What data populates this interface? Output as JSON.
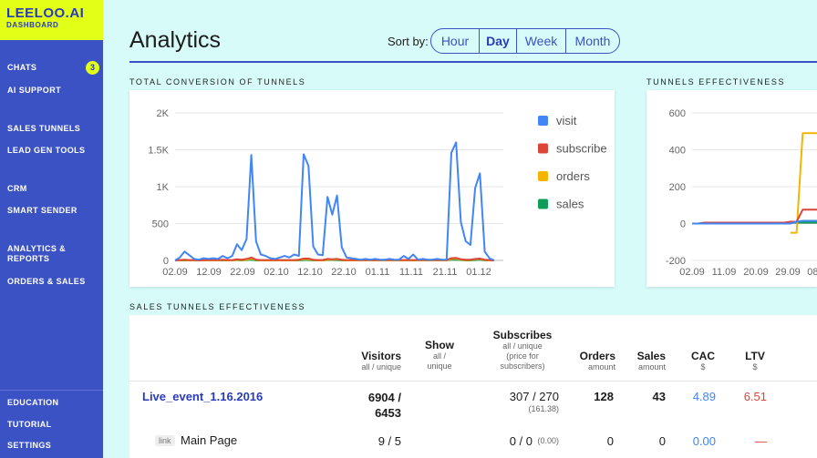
{
  "brand": {
    "name": "LEELOO.AI",
    "subtitle": "DASHBOARD"
  },
  "sidebar": {
    "items": [
      {
        "label": "CHATS",
        "badge": "3"
      },
      {
        "label": "AI SUPPORT"
      },
      {
        "label": "SALES TUNNELS"
      },
      {
        "label": "LEAD GEN TOOLS"
      },
      {
        "label": "CRM"
      },
      {
        "label": "SMART SENDER"
      },
      {
        "label": "ANALYTICS &\nREPORTS"
      },
      {
        "label": "ORDERS & SALES"
      }
    ],
    "bottom_items": [
      {
        "label": "EDUCATION"
      },
      {
        "label": "TUTORIAL"
      },
      {
        "label": "SETTINGS"
      }
    ]
  },
  "header": {
    "title": "Analytics",
    "sort_label": "Sort by:",
    "sort_options": [
      "Hour",
      "Day",
      "Week",
      "Month"
    ],
    "active_sort": "Day"
  },
  "sections": {
    "total_conversion": "TOTAL CONVERSION OF TUNNELS",
    "tunnels_effectiveness": "TUNNELS EFFECTIVENESS",
    "sales_tunnels_effectiveness": "SALES TUNNELS EFFECTIVENESS"
  },
  "colors": {
    "accent": "#3b52c4",
    "brand_yellow": "#e2ff17",
    "visit": "#4285f4",
    "subscribe": "#db4437",
    "orders": "#f4b400",
    "sales": "#0f9d58",
    "cac": "#4285f4",
    "ltv": "#db4437"
  },
  "chart_data": [
    {
      "type": "line",
      "title": "TOTAL CONVERSION OF TUNNELS",
      "x_ticks": [
        "02.09",
        "12.09",
        "22.09",
        "02.10",
        "12.10",
        "22.10",
        "01.11",
        "11.11",
        "21.11",
        "01.12"
      ],
      "y_ticks": [
        "0",
        "500",
        "1K",
        "1.5K",
        "2K"
      ],
      "ylim": [
        0,
        2000
      ],
      "legend": [
        "visit",
        "subscribe",
        "orders",
        "sales"
      ],
      "legend_position": "right",
      "grid": true,
      "series": [
        {
          "name": "visit",
          "color": "#4285f4",
          "values": [
            0,
            40,
            120,
            70,
            20,
            10,
            30,
            20,
            30,
            20,
            60,
            30,
            60,
            220,
            140,
            290,
            1430,
            260,
            80,
            60,
            30,
            20,
            40,
            60,
            40,
            80,
            60,
            1440,
            1280,
            190,
            80,
            70,
            860,
            620,
            880,
            180,
            40,
            30,
            20,
            10,
            20,
            10,
            20,
            10,
            10,
            20,
            10,
            10,
            60,
            20,
            80,
            10,
            20,
            10,
            10,
            20,
            10,
            10,
            1460,
            1600,
            520,
            260,
            210,
            980,
            1180,
            120,
            30,
            0
          ]
        },
        {
          "name": "subscribe",
          "color": "#db4437",
          "values": [
            0,
            5,
            10,
            5,
            5,
            0,
            5,
            5,
            5,
            5,
            10,
            5,
            5,
            15,
            10,
            20,
            40,
            10,
            5,
            5,
            5,
            5,
            5,
            5,
            5,
            5,
            10,
            25,
            25,
            10,
            5,
            5,
            20,
            15,
            20,
            10,
            5,
            5,
            5,
            5,
            5,
            5,
            5,
            5,
            5,
            5,
            5,
            5,
            5,
            5,
            5,
            5,
            5,
            5,
            5,
            5,
            5,
            5,
            30,
            35,
            15,
            10,
            10,
            20,
            25,
            10,
            5,
            0
          ]
        },
        {
          "name": "orders",
          "color": "#f4b400",
          "values": [
            0,
            0,
            5,
            0,
            0,
            0,
            0,
            0,
            0,
            0,
            5,
            0,
            0,
            10,
            5,
            10,
            25,
            5,
            0,
            0,
            0,
            0,
            0,
            0,
            0,
            0,
            5,
            15,
            15,
            5,
            0,
            0,
            10,
            10,
            15,
            5,
            0,
            0,
            0,
            0,
            0,
            0,
            0,
            0,
            0,
            0,
            0,
            0,
            0,
            0,
            0,
            0,
            0,
            0,
            0,
            0,
            0,
            0,
            20,
            25,
            10,
            5,
            5,
            15,
            20,
            5,
            0,
            0
          ]
        },
        {
          "name": "sales",
          "color": "#0f9d58",
          "values": [
            0,
            0,
            0,
            0,
            0,
            0,
            0,
            0,
            0,
            0,
            0,
            0,
            0,
            5,
            0,
            5,
            10,
            0,
            0,
            0,
            0,
            0,
            0,
            0,
            0,
            0,
            0,
            5,
            5,
            0,
            0,
            0,
            5,
            5,
            5,
            0,
            0,
            0,
            0,
            0,
            0,
            0,
            0,
            0,
            0,
            0,
            0,
            0,
            0,
            0,
            0,
            0,
            0,
            0,
            0,
            0,
            0,
            0,
            10,
            10,
            5,
            0,
            0,
            5,
            10,
            0,
            0,
            0
          ]
        }
      ]
    },
    {
      "type": "line",
      "title": "TUNNELS EFFECTIVENESS",
      "x_ticks": [
        "02.09",
        "11.09",
        "20.09",
        "29.09",
        "08.10"
      ],
      "y_ticks": [
        "-200",
        "0",
        "200",
        "400",
        "600"
      ],
      "ylim": [
        -200,
        600
      ],
      "grid": true,
      "series": [
        {
          "color": "#4285f4",
          "values": [
            0,
            0,
            0,
            0,
            0,
            0,
            0,
            0,
            0,
            0,
            0,
            0,
            0,
            0,
            0,
            0,
            0,
            10,
            15,
            15,
            15,
            15,
            15,
            15
          ]
        },
        {
          "color": "#db4437",
          "values": [
            0,
            0,
            5,
            5,
            5,
            5,
            5,
            5,
            5,
            5,
            5,
            5,
            5,
            5,
            5,
            5,
            10,
            10,
            75,
            75,
            75,
            75,
            60,
            60
          ]
        },
        {
          "color": "#f4b400",
          "values": [
            null,
            null,
            null,
            null,
            null,
            null,
            null,
            null,
            null,
            null,
            null,
            null,
            null,
            null,
            null,
            null,
            -50,
            -50,
            490,
            490,
            490,
            490,
            495,
            495
          ]
        },
        {
          "color": "#0f9d58",
          "values": [
            0,
            0,
            0,
            0,
            0,
            0,
            0,
            0,
            0,
            0,
            0,
            0,
            0,
            0,
            0,
            0,
            5,
            5,
            5,
            5,
            5,
            5,
            5,
            5
          ]
        }
      ]
    }
  ],
  "table": {
    "columns": [
      {
        "label": "Visitors",
        "sub": "all / unique"
      },
      {
        "label": "Show",
        "sub": "all /\nunique"
      },
      {
        "label": "Subscribes",
        "sub": "all / unique\n(price for\nsubscribers)"
      },
      {
        "label": "Orders",
        "sub": "amount"
      },
      {
        "label": "Sales",
        "sub": "amount"
      },
      {
        "label": "CAC",
        "sub": "$"
      },
      {
        "label": "LTV",
        "sub": "$"
      }
    ],
    "rows": [
      {
        "name": "Live_event_1.16.2016",
        "visitors": "6904 /\n6453",
        "subscribes": "307 / 270",
        "subscribes_price": "(161.38)",
        "orders": "128",
        "sales": "43",
        "cac": "4.89",
        "ltv": "6.51"
      },
      {
        "tag": "link",
        "name": "Main Page",
        "visitors": "9 / 5",
        "subscribes": "0 / 0",
        "subscribes_price": "(0.00)",
        "orders": "0",
        "sales": "0",
        "cac": "0.00",
        "ltv": "—"
      }
    ]
  }
}
